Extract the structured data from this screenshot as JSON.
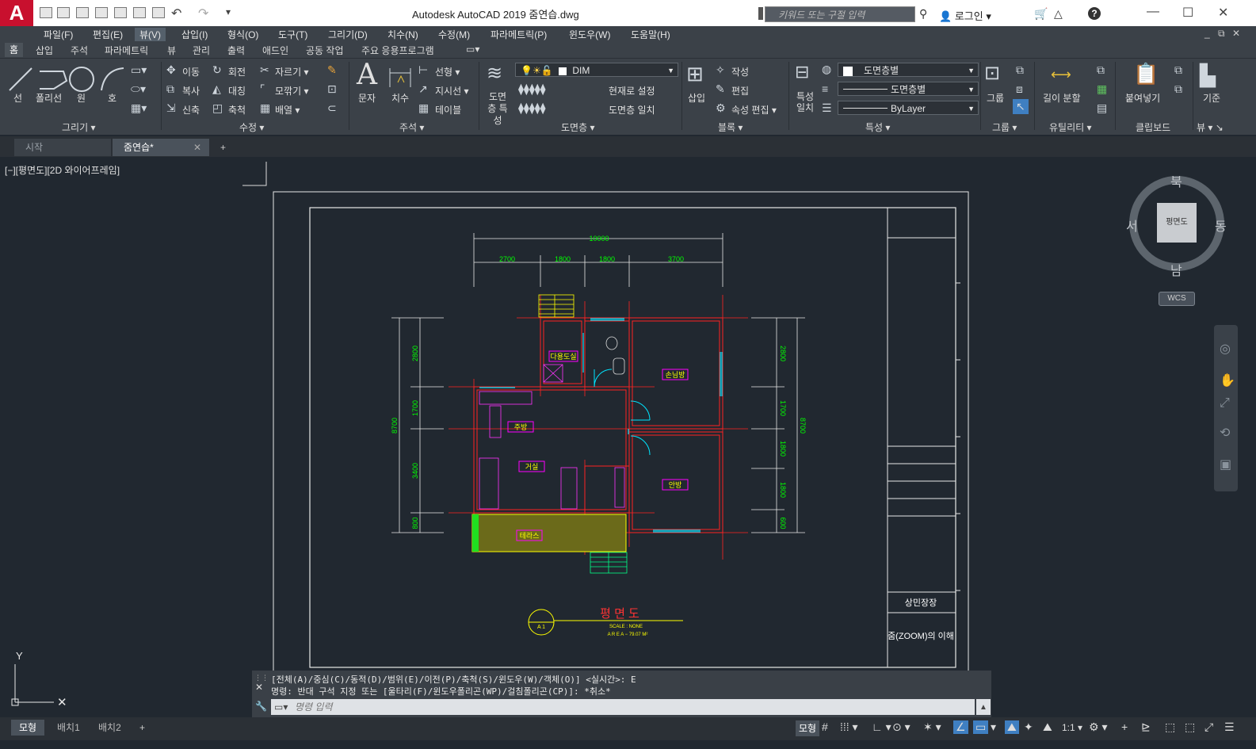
{
  "titlebar": {
    "app_logo": "A",
    "title": "Autodesk AutoCAD 2019     줌연습.dwg",
    "search_placeholder": "키워드 또는 구절 입력",
    "login": "로그인",
    "help": "?"
  },
  "menubar": [
    "파일(F)",
    "편집(E)",
    "뷰(V)",
    "삽입(I)",
    "형식(O)",
    "도구(T)",
    "그리기(D)",
    "치수(N)",
    "수정(M)",
    "파라메트릭(P)",
    "윈도우(W)",
    "도움말(H)"
  ],
  "ribbon_tabs": [
    "홈",
    "삽입",
    "주석",
    "파라메트릭",
    "뷰",
    "관리",
    "출력",
    "애드인",
    "공동 작업",
    "주요 응용프로그램"
  ],
  "ribbon": {
    "draw": {
      "title": "그리기",
      "line": "선",
      "polyline": "폴리선",
      "circle": "원",
      "arc": "호"
    },
    "modify": {
      "title": "수정",
      "move": "이동",
      "rotate": "회전",
      "trim": "자르기",
      "copy": "복사",
      "mirror": "대칭",
      "fillet": "모깎기",
      "stretch": "신축",
      "scale": "축척",
      "array": "배열"
    },
    "annotation": {
      "title": "주석",
      "text": "문자",
      "dimension": "치수",
      "linear": "선형",
      "leader": "지시선",
      "table": "테이블"
    },
    "layers": {
      "title": "도면층",
      "properties": "도면층 특성",
      "current_layer": "DIM",
      "make_current": "현재로 설정",
      "match": "도면층 일치"
    },
    "block": {
      "title": "블록",
      "insert": "삽입",
      "create": "작성",
      "edit": "편집",
      "edit_attr": "속성 편집"
    },
    "properties": {
      "title": "특성",
      "match": "특성 일치",
      "color": "도면층별",
      "linetype": "도면층별",
      "lineweight": "ByLayer"
    },
    "groups": {
      "title": "그룹",
      "group": "그룹"
    },
    "utilities": {
      "title": "유틸리티",
      "measure": "길이 분할"
    },
    "clipboard": {
      "title": "클립보드",
      "paste": "붙여넣기"
    },
    "view": {
      "title": "뷰",
      "base": "기준"
    }
  },
  "doc_tabs": [
    {
      "label": "시작"
    },
    {
      "label": "줌연습*"
    }
  ],
  "viewport_label": "[−][평면도][2D 와이어프레임]",
  "viewcube": {
    "face": "평면도",
    "north": "북",
    "south": "남",
    "east": "동",
    "west": "서",
    "wcs": "WCS"
  },
  "drawing": {
    "dims_top": [
      "10000",
      "2700",
      "1800",
      "1800",
      "3700"
    ],
    "dims_left": [
      "2800",
      "1700",
      "3400",
      "800",
      "8700"
    ],
    "dims_right": [
      "2800",
      "1700",
      "1800",
      "1800",
      "600",
      "8700"
    ],
    "rooms": [
      "다용도실",
      "손님방",
      "주방",
      "거실",
      "안방",
      "테라스"
    ],
    "title": "평 면 도",
    "scale": "SCALE : NONE",
    "area": "A R E A − 79.07 M²",
    "callout": "A 1",
    "titleblock_company": "상민장장",
    "titleblock_name": "줌(ZOOM)의 이해"
  },
  "command": {
    "line1": "[전체(A)/중심(C)/동적(D)/범위(E)/이전(P)/축척(S)/윈도우(W)/객체(O)] <실시간>: E",
    "line2": "명령: 반대 구석 지정 또는 [울타리(F)/윈도우폴리곤(WP)/걸침폴리곤(CP)]: *취소*",
    "placeholder": "명령 입력"
  },
  "layout_tabs": [
    "모형",
    "배치1",
    "배치2"
  ],
  "status": {
    "model": "모형",
    "scale": "1:1"
  },
  "colors": {
    "accent": "#c8102e",
    "canvas": "#212830",
    "ribbon": "#3b4148",
    "dim": "#00ff00",
    "wall": "#ff0000",
    "room_label": "#ff00ff"
  }
}
